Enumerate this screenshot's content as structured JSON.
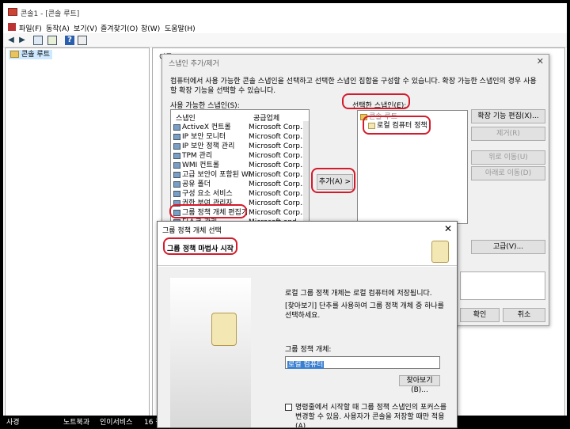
{
  "window": {
    "title": "콘솔1 - [콘솔 루트]"
  },
  "menu": [
    "파일(F)",
    "동작(A)",
    "보기(V)",
    "즐겨찾기(O)",
    "창(W)",
    "도움말(H)"
  ],
  "toolbar": {
    "icons": [
      "back-icon",
      "forward-icon",
      "show-tree-icon",
      "export-icon",
      "help-icon",
      "properties-icon"
    ]
  },
  "tree": {
    "root": "콘솔 루트"
  },
  "content": {
    "name_header": "이름"
  },
  "status": {
    "items": [
      "사경",
      "노트북과",
      "인이서비스",
      "16 장"
    ]
  },
  "snapin_dialog": {
    "title": "스냅인 추가/제거",
    "description": "컴퓨터에서 사용 가능한 콘솔 스냅인을 선택하고 선택한 스냅인 집합을 구성할 수 있습니다. 확장 가능한 스냅인의 경우 사용할 확장 기능을 선택할 수 있습니다.",
    "available_label": "사용 가능한 스냅인(S):",
    "col_snapin": "스냅인",
    "col_vendor": "공급업체",
    "available": [
      {
        "name": "ActiveX 컨트롤",
        "vendor": "Microsoft Corp..."
      },
      {
        "name": "IP 보안 모니터",
        "vendor": "Microsoft Corp..."
      },
      {
        "name": "IP 보안 정책 관리",
        "vendor": "Microsoft Corp..."
      },
      {
        "name": "TPM 관리",
        "vendor": "Microsoft Corp..."
      },
      {
        "name": "WMI 컨트롤",
        "vendor": "Microsoft Corp..."
      },
      {
        "name": "고급 보안이 포함된 Wi...",
        "vendor": "Microsoft Corp..."
      },
      {
        "name": "공유 폴더",
        "vendor": "Microsoft Corp..."
      },
      {
        "name": "구성 요소 서비스",
        "vendor": "Microsoft Corp..."
      },
      {
        "name": "권한 부여 관리자",
        "vendor": "Microsoft Corp..."
      },
      {
        "name": "그룹 정책 개체 편집기",
        "vendor": "Microsoft Corp..."
      },
      {
        "name": "디스크 관리",
        "vendor": "Microsoft and..."
      }
    ],
    "add_button": "추가(A) >",
    "selected_label": "선택한 스냅인(E):",
    "selected_root": "콘솔 루트",
    "selected_item": "로컬 컴퓨터 정책",
    "buttons": {
      "edit_ext": "확장 기능 편집(X)...",
      "remove": "제거(R)",
      "move_up": "위로 이동(U)",
      "move_down": "아래로 이동(D)",
      "advanced": "고급(V)...",
      "ok": "확인",
      "cancel": "취소"
    }
  },
  "gpo_dialog": {
    "title": "그룹 정책 개체 선택",
    "heading": "그룹 정책 마법사 시작",
    "line1": "로컬 그룹 정책 개체는 로컬 컴퓨터에 저장됩니다.",
    "line2": "[찾아보기] 단추를 사용하여 그룹 정책 개체 중 하나를 선택하세요.",
    "field_label": "그룹 정책 개체:",
    "field_value": "로컬 컴퓨터",
    "browse": "찾아보기(B)...",
    "checkbox": "명령줄에서 시작할 때 그룹 정책 스냅인의 포커스를 변경할 수 있음. 사용자가 콘솔을 저장할 때만 적용(A)",
    "checked": false
  },
  "annotation_color": "#d41b2c"
}
